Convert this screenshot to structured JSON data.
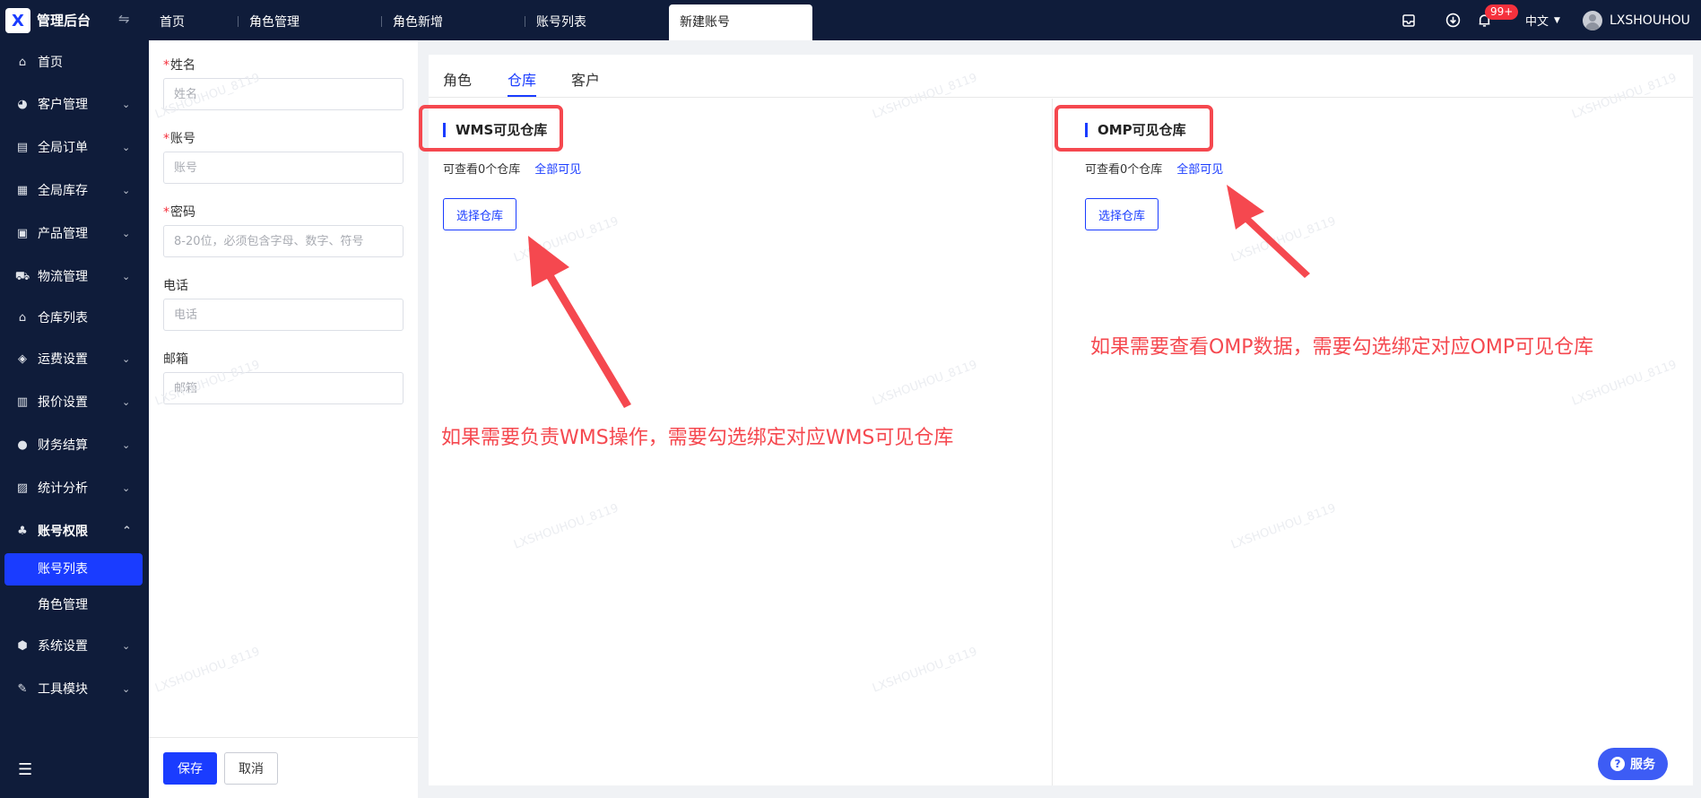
{
  "app": {
    "brand": "管理后台",
    "logo_glyph": "X"
  },
  "tabs": [
    {
      "label": "首页"
    },
    {
      "label": "角色管理"
    },
    {
      "label": "角色新增"
    },
    {
      "label": "账号列表"
    },
    {
      "label": "新建账号",
      "active": true
    }
  ],
  "header": {
    "notification_count": "99+",
    "language": "中文",
    "username": "LXSHOUHOU"
  },
  "sidebar": {
    "items": [
      {
        "label": "首页",
        "icon": "home-icon"
      },
      {
        "label": "客户管理",
        "icon": "users-icon"
      },
      {
        "label": "全局订单",
        "icon": "clipboard-icon"
      },
      {
        "label": "全局库存",
        "icon": "warehouse-icon"
      },
      {
        "label": "产品管理",
        "icon": "package-icon"
      },
      {
        "label": "物流管理",
        "icon": "truck-icon"
      },
      {
        "label": "仓库列表",
        "icon": "house-icon"
      },
      {
        "label": "运费设置",
        "icon": "box-icon"
      },
      {
        "label": "报价设置",
        "icon": "document-icon"
      },
      {
        "label": "财务结算",
        "icon": "coin-icon"
      },
      {
        "label": "统计分析",
        "icon": "chart-icon"
      },
      {
        "label": "账号权限",
        "icon": "org-chart-icon",
        "expanded": true
      },
      {
        "label": "系统设置",
        "icon": "hexagon-icon"
      },
      {
        "label": "工具模块",
        "icon": "wrench-icon"
      }
    ],
    "subitems": [
      {
        "label": "账号列表",
        "active": true
      },
      {
        "label": "角色管理"
      }
    ]
  },
  "form": {
    "name": {
      "label": "姓名",
      "placeholder": "姓名",
      "required": true,
      "value": ""
    },
    "account": {
      "label": "账号",
      "placeholder": "账号",
      "required": true,
      "value": ""
    },
    "password": {
      "label": "密码",
      "placeholder": "8-20位，必须包含字母、数字、符号",
      "required": true,
      "value": ""
    },
    "phone": {
      "label": "电话",
      "placeholder": "电话",
      "value": ""
    },
    "email": {
      "label": "邮箱",
      "placeholder": "邮箱",
      "value": ""
    },
    "save_label": "保存",
    "cancel_label": "取消"
  },
  "panel": {
    "tabs": [
      {
        "label": "角色"
      },
      {
        "label": "仓库",
        "active": true
      },
      {
        "label": "客户"
      }
    ],
    "wms": {
      "title": "WMS可见仓库",
      "count_text": "可查看0个仓库",
      "all_link": "全部可见",
      "select_button": "选择仓库"
    },
    "omp": {
      "title": "OMP可见仓库",
      "count_text": "可查看0个仓库",
      "all_link": "全部可见",
      "select_button": "选择仓库"
    }
  },
  "annotations": {
    "wms_note": "如果需要负责WMS操作，需要勾选绑定对应WMS可见仓库",
    "omp_note": "如果需要查看OMP数据，需要勾选绑定对应OMP可见仓库"
  },
  "service_button": "服务",
  "watermark": "LXSHOUHOU_8119",
  "colors": {
    "nav_bg": "#0f1c3a",
    "accent": "#1a3cff",
    "annotation": "#f5484f",
    "badge": "#f5313d"
  }
}
